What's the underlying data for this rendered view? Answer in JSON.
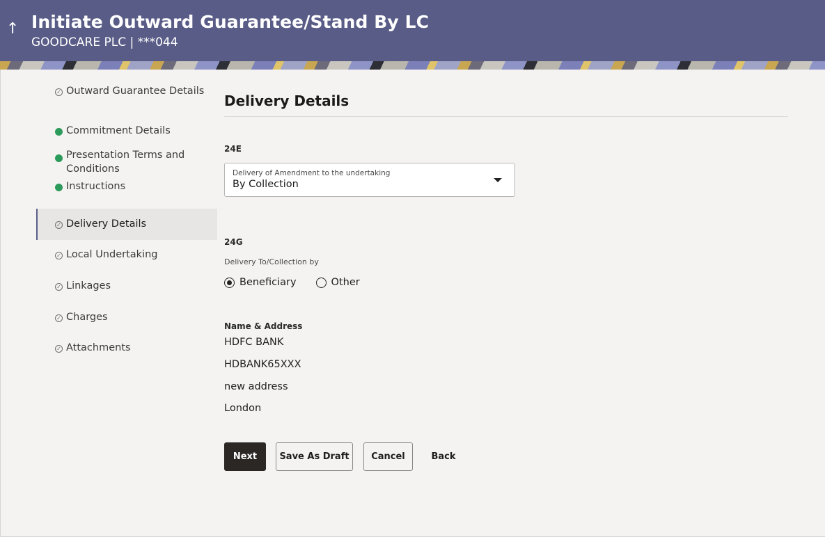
{
  "header": {
    "title": "Initiate Outward Guarantee/Stand By LC",
    "subtitle": "GOODCARE PLC | ***044",
    "back_icon": "↑"
  },
  "nav": {
    "items": [
      {
        "label": "Outward Guarantee Details",
        "status": "pending"
      },
      {
        "label": "Commitment Details",
        "status": "done"
      },
      {
        "label": "Presentation Terms and Conditions",
        "status": "done"
      },
      {
        "label": "Instructions",
        "status": "done"
      },
      {
        "label": "Delivery Details",
        "status": "active"
      },
      {
        "label": "Local Undertaking",
        "status": "pending"
      },
      {
        "label": "Linkages",
        "status": "pending"
      },
      {
        "label": "Charges",
        "status": "pending"
      },
      {
        "label": "Attachments",
        "status": "pending"
      }
    ]
  },
  "main": {
    "title": "Delivery Details",
    "field_24e": {
      "code": "24E",
      "label": "Delivery of Amendment to the undertaking",
      "value": "By Collection"
    },
    "field_24g": {
      "code": "24G",
      "caption": "Delivery To/Collection by",
      "options": [
        {
          "label": "Beneficiary",
          "checked": true
        },
        {
          "label": "Other",
          "checked": false
        }
      ]
    },
    "name_address": {
      "heading": "Name & Address",
      "lines": [
        "HDFC BANK",
        "HDBANK65XXX",
        "new address",
        "London"
      ]
    },
    "buttons": {
      "next": "Next",
      "save_draft": "Save As Draft",
      "cancel": "Cancel",
      "back": "Back"
    }
  },
  "colors": {
    "header_bg": "#585c86",
    "success": "#2c9a5a",
    "primary_button": "#2b2725"
  }
}
